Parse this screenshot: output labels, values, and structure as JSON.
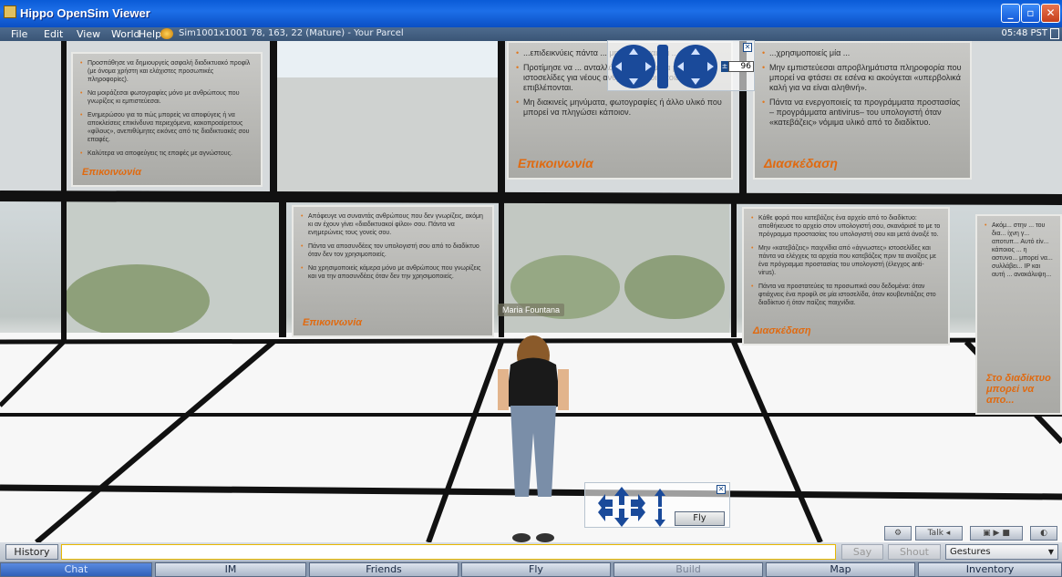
{
  "window": {
    "title": "Hippo OpenSim Viewer"
  },
  "menu": {
    "items": [
      "File",
      "Edit",
      "View",
      "World",
      "Help"
    ]
  },
  "status": {
    "region": "Sim1001x1001 78, 163, 22 (Mature) - Your Parcel",
    "time": "05:48 PST"
  },
  "avatar": {
    "name": "Maria Fountana"
  },
  "posters": [
    {
      "category": "Επικοινωνία",
      "bullets": [
        "Προσπάθησε να δημιουργείς ασφαλή διαδικτυακό προφίλ (με όνομα χρήστη και ελάχιστες προσωπικές πληροφορίες).",
        "Να μοιράζεσαι φωτογραφίες μόνο με ανθρώπους που γνωρίζεις κι εμπιστεύεσαι.",
        "Ενημερώσου για το πώς μπορείς να αποφύγεις ή να αποκλείσεις επικίνδυνα περιεχόμενα, κακοπροαίρετους «φίλους», ανεπιθύμητες εικόνες από τις διαδικτυακές σου επαφές.",
        "Καλύτερα να αποφεύγεις τις επαφές με αγνώστους."
      ]
    },
    {
      "category": "Επικοινωνία",
      "bullets": [
        "...επιδεικνύεις πάντα ... μη σκέφτεσαι ότι ... οθόνη.",
        "Προτίμησε να ... ανταλλάσσεις μηνύματα μέσα από ιστοσελίδες για νέους ανθρώπους, οι οποίες επιβλέπονται.",
        "Μη διακινείς μηνύματα, φωτογραφίες ή άλλο υλικό που μπορεί να πληγώσει κάποιον."
      ]
    },
    {
      "category": "Διασκέδαση",
      "bullets": [
        "...χρησιμοποιείς μία ...",
        "Μην εμπιστεύεσαι απροβλημάτιστα πληροφορία που μπορεί να φτάσει σε εσένα κι ακούγεται «υπερβολικά καλή για να είναι αληθινή».",
        "Πάντα να ενεργοποιείς τα προγράμματα προστασίας – προγράμματα antivirus– του υπολογιστή όταν «κατεβάζεις» νόμιμα υλικό από το διαδίκτυο."
      ]
    },
    {
      "category": "Επικοινωνία",
      "bullets": [
        "Απόφευγε να συναντάς ανθρώπους που δεν γνωρίζεις, ακόμη κι αν έχουν γίνει «διαδικτυακοί φίλοι» σου. Πάντα να ενημερώνεις τους γονείς σου.",
        "Πάντα να αποσυνδέεις τον υπολογιστή σου από το διαδίκτυο όταν δεν τον χρησιμοποιείς.",
        "Να χρησιμοποιείς κάμερα μόνο με ανθρώπους που γνωρίζεις και να την αποσυνδέεις όταν δεν την χρησιμοποιείς."
      ]
    },
    {
      "category": "Διασκέδαση",
      "bullets": [
        "Κάθε φορά που κατεβάζεις ένα αρχείο από το διαδίκτυο: αποθήκευσε το αρχείο στον υπολογιστή σου, σκανάρισέ το με το πρόγραμμα προστασίας του υπολογιστή σου και μετά άνοιξέ το.",
        "Μην «κατεβάζεις» παιχνίδια από «άγνωστες» ιστοσελίδες και πάντα να ελέγχεις τα αρχεία που κατεβάζεις πριν τα ανοίξεις με ένα πρόγραμμα προστασίας του υπολογιστή (έλεγχος anti-virus).",
        "Πάντα να προστατεύεις τα προσωπικά σου δεδομένα: όταν φτιάχνεις ένα προφίλ σε μία ιστοσελίδα, όταν κουβεντιάζεις στο διαδίκτυο ή όταν παίζεις παιχνίδια."
      ]
    },
    {
      "category": "Στο διαδίκτυο μπορεί να απο...",
      "bullets": [
        "Ακόμ... στην ... του δια... ίχνη γ... αποτυπ... Αυτό είν... κάποιος ... η αστυνο... μπορεί να... συλλάβει... IP και αυτή ... ανακάλυψη..."
      ]
    }
  ],
  "camera": {
    "zoom": "96"
  },
  "movement": {
    "fly_label": "Fly"
  },
  "voice": {
    "talk_label": "Talk"
  },
  "chat": {
    "history_label": "History",
    "input_value": "",
    "say_label": "Say",
    "shout_label": "Shout",
    "gestures_label": "Gestures"
  },
  "toolbar": {
    "buttons": [
      "Chat",
      "IM",
      "Friends",
      "Fly",
      "Build",
      "Map",
      "Inventory"
    ]
  },
  "colors": {
    "accent": "#0a5bd7",
    "poster_title": "#e06a10",
    "chat_active": "#3a6cc8"
  }
}
